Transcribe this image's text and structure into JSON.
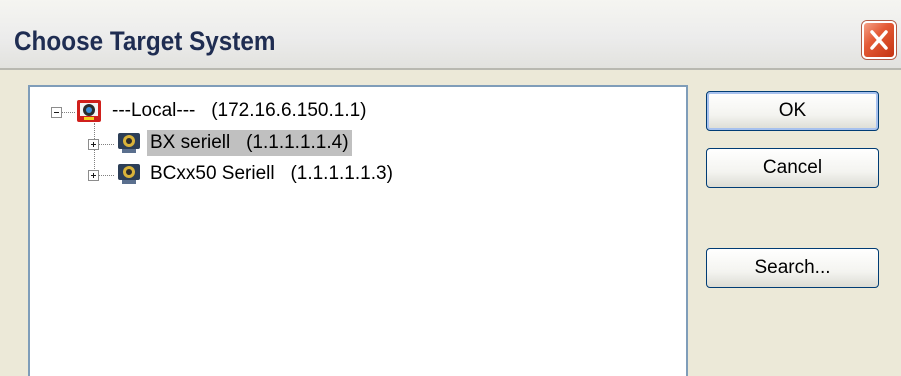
{
  "window": {
    "title": "Choose Target System"
  },
  "tree": {
    "root": {
      "label": "---Local---   (172.16.6.150.1.1)",
      "expander": "minus",
      "icon": "network-computer-icon"
    },
    "children": [
      {
        "label": "BX seriell   (1.1.1.1.1.4)",
        "selected": true,
        "expander": "plus",
        "icon": "serial-device-icon"
      },
      {
        "label": "BCxx50 Seriell   (1.1.1.1.1.3)",
        "selected": false,
        "expander": "plus",
        "icon": "serial-device-icon"
      }
    ]
  },
  "buttons": {
    "ok": "OK",
    "cancel": "Cancel",
    "search": "Search..."
  },
  "colors": {
    "title_text": "#1f2d52",
    "dialog_bg": "#ece9d8",
    "close_red": "#e45a36",
    "selection_bg": "#c0c0c0",
    "button_border": "#003c74"
  }
}
